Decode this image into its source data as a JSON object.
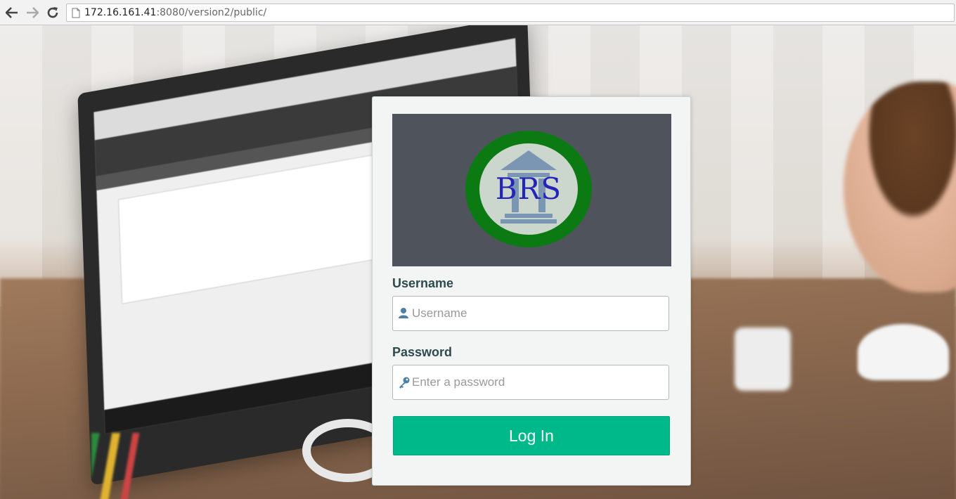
{
  "browser": {
    "url_host": "172.16.161.41",
    "url_path": ":8080/version2/public/",
    "back_icon": "arrow-left-icon",
    "forward_icon": "arrow-right-icon",
    "reload_icon": "reload-icon",
    "page_icon": "document-icon"
  },
  "logo": {
    "text": "BRS",
    "ring_color": "#0c7a12",
    "text_color": "#2424b8",
    "panel_color": "#4f545c"
  },
  "form": {
    "username_label": "Username",
    "username_placeholder": "Username",
    "username_value": "",
    "password_label": "Password",
    "password_placeholder": "Enter a password",
    "password_value": "",
    "login_label": "Log In",
    "accent_color": "#00b98b"
  }
}
